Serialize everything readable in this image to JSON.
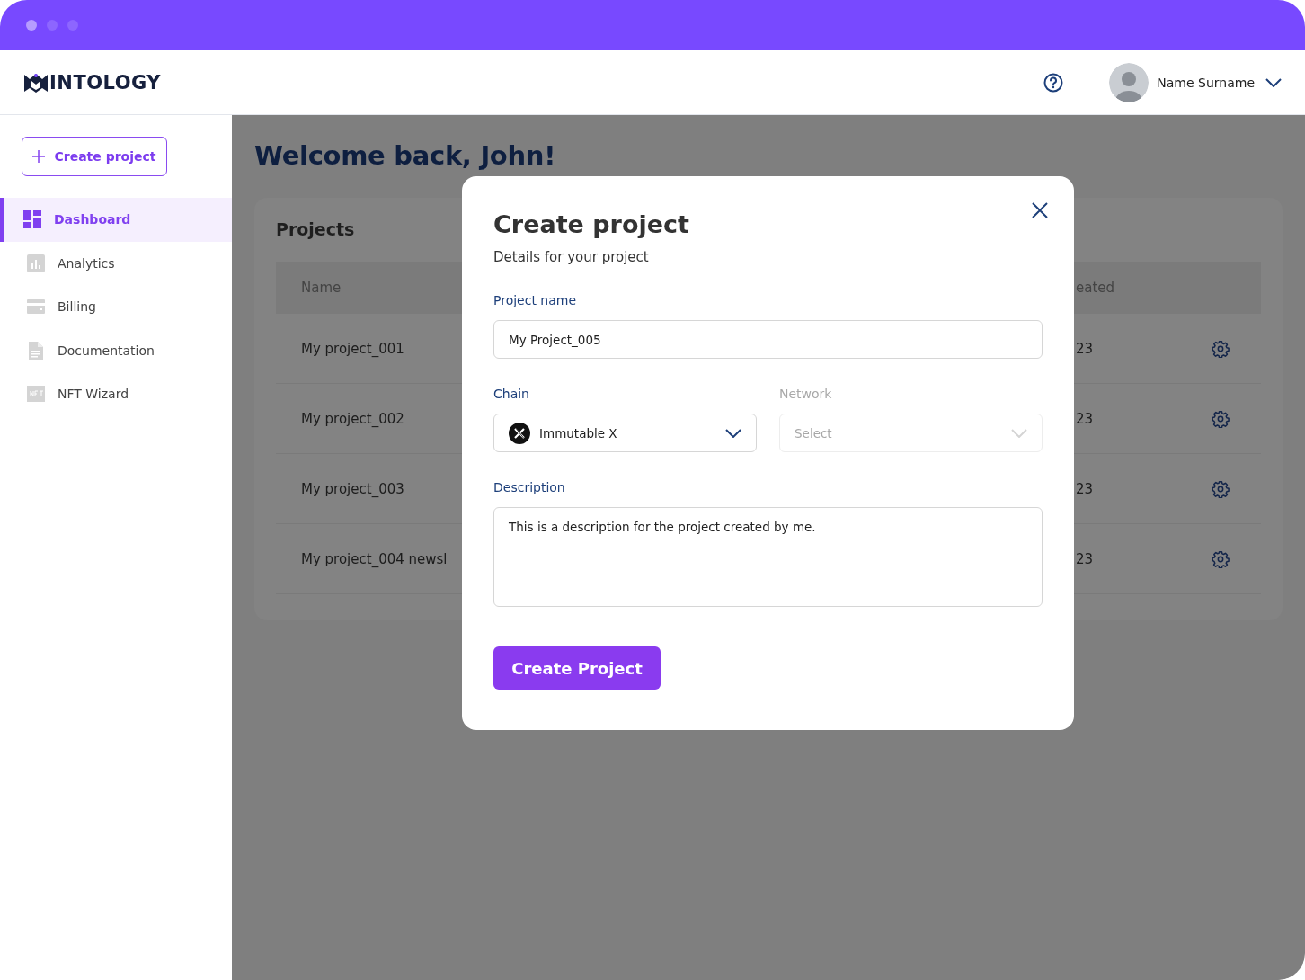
{
  "header": {
    "logo": "INTOLOGY",
    "user_name": "Name Surname"
  },
  "sidebar": {
    "create_button": "Create project",
    "items": [
      {
        "label": "Dashboard",
        "selected": true
      },
      {
        "label": "Analytics",
        "selected": false
      },
      {
        "label": "Billing",
        "selected": false
      },
      {
        "label": "Documentation",
        "selected": false
      },
      {
        "label": "NFT Wizard",
        "selected": false
      }
    ]
  },
  "main": {
    "greeting": "Welcome back, John!",
    "projects": {
      "title": "Projects",
      "columns": [
        "Name",
        "eated"
      ],
      "rows": [
        {
          "name": "My project_001",
          "column_2": "23"
        },
        {
          "name": "My project_002",
          "column_2": "23"
        },
        {
          "name": "My project_003",
          "column_2": "23"
        },
        {
          "name": "My project_004 newsl",
          "column_2": "23"
        }
      ]
    }
  },
  "dialog": {
    "title": "Create project",
    "subtitle": "Details for your project",
    "fields": [
      {
        "kind": "text",
        "label": "Project name",
        "value": "My Project_005"
      },
      {
        "kind": "select",
        "label": "Chain",
        "value": "Immutable X",
        "disabled": false
      },
      {
        "kind": "select",
        "label": "Network",
        "placeholder": "Select",
        "disabled": true
      },
      {
        "kind": "textarea",
        "label": "Description",
        "value": "This is a description for the project created by me."
      }
    ],
    "button": "Create Project"
  }
}
